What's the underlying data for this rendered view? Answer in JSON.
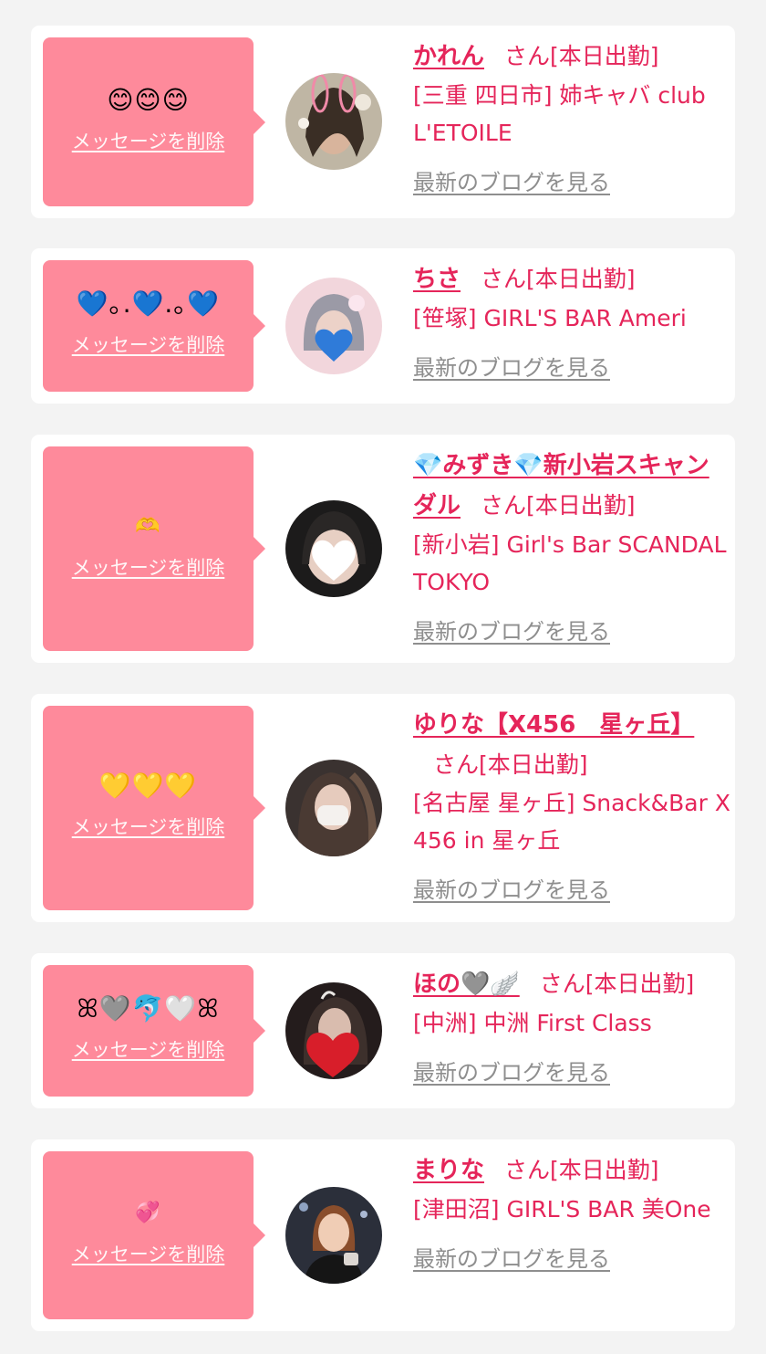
{
  "cards": [
    {
      "message": "😊😊😊",
      "delete_label": "メッセージを削除",
      "name": "かれん",
      "san": "さん",
      "status": "[本日出勤]",
      "shop": "[三重 四日市] 姉キャバ club L'ETOILE",
      "blog_label": "最新のブログを見る"
    },
    {
      "message": "💙｡.💙.｡💙",
      "delete_label": "メッセージを削除",
      "name": "ちさ",
      "san": "さん",
      "status": "[本日出勤]",
      "shop": "[笹塚] GIRL'S BAR Ameri",
      "blog_label": "最新のブログを見る"
    },
    {
      "message": "🫶",
      "delete_label": "メッセージを削除",
      "name": "💎みずき💎新小岩スキャンダル",
      "san": "さん",
      "status": "[本日出勤]",
      "shop": "[新小岩] Girl's Bar SCANDAL TOKYO",
      "blog_label": "最新のブログを見る"
    },
    {
      "message": "💛💛💛",
      "delete_label": "メッセージを削除",
      "name": "ゆりな【X456　星ヶ丘】",
      "san": "さん",
      "status": "[本日出勤]",
      "shop": "[名古屋 星ヶ丘] Snack&Bar X 456 in 星ヶ丘",
      "blog_label": "最新のブログを見る"
    },
    {
      "message": "ꕤ🩶🐬🤍ꕤ",
      "delete_label": "メッセージを削除",
      "name": "ほの🩶🪽",
      "san": "さん",
      "status": "[本日出勤]",
      "shop": "[中洲] 中洲 First Class",
      "blog_label": "最新のブログを見る"
    },
    {
      "message": "💞",
      "delete_label": "メッセージを削除",
      "name": "まりな",
      "san": "さん",
      "status": "[本日出勤]",
      "shop": "[津田沼] GIRL'S BAR 美One",
      "blog_label": "最新のブログを見る"
    }
  ],
  "colors": {
    "background": "#f3f3f3",
    "card": "#ffffff",
    "bubble": "#fe8a9b",
    "accent_text": "#e5255a",
    "link_gray": "#8e8e8e"
  }
}
